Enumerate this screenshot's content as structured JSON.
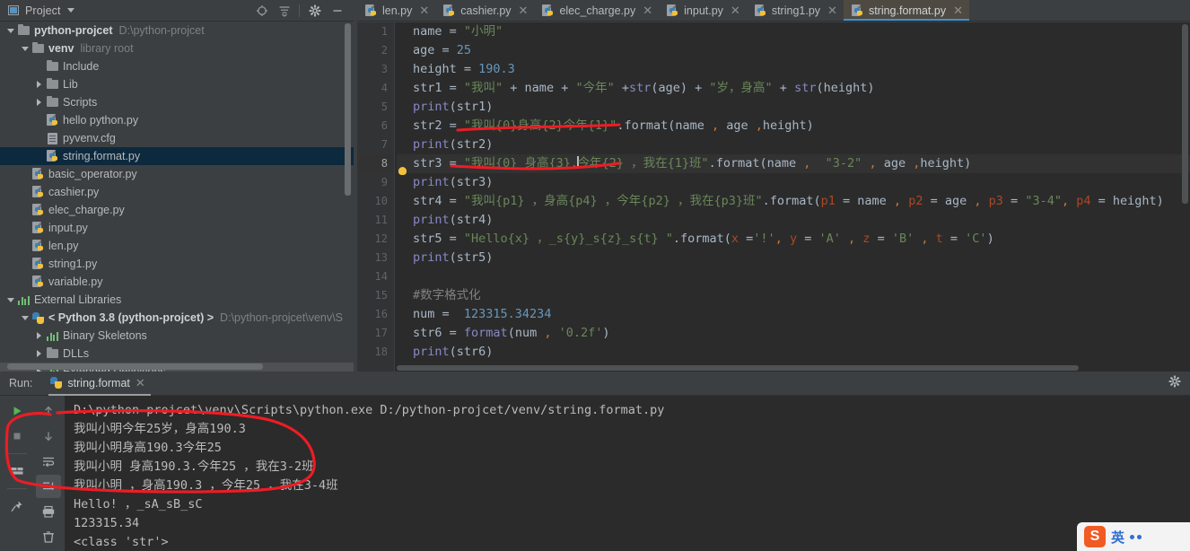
{
  "project_panel": {
    "title": "Project",
    "toolbar_icons": [
      "locate-icon",
      "collapse-all-icon",
      "settings-gear-icon",
      "minimize-icon"
    ],
    "tree": [
      {
        "indent": 0,
        "twisty": "down",
        "icon": "folder-icon",
        "label": "python-projcet",
        "bold": true,
        "dim": "D:\\python-projcet",
        "state": "normal"
      },
      {
        "indent": 1,
        "twisty": "down",
        "icon": "folder-icon",
        "label": "venv",
        "bold": true,
        "dim": "library root",
        "state": "normal"
      },
      {
        "indent": 2,
        "twisty": "none",
        "icon": "folder-icon",
        "label": "Include",
        "bold": false,
        "dim": "",
        "state": "normal"
      },
      {
        "indent": 2,
        "twisty": "right",
        "icon": "folder-icon",
        "label": "Lib",
        "bold": false,
        "dim": "",
        "state": "normal"
      },
      {
        "indent": 2,
        "twisty": "right",
        "icon": "folder-icon",
        "label": "Scripts",
        "bold": false,
        "dim": "",
        "state": "normal"
      },
      {
        "indent": 2,
        "twisty": "none",
        "icon": "python-file-icon",
        "label": "hello python.py",
        "bold": false,
        "dim": "",
        "state": "normal"
      },
      {
        "indent": 2,
        "twisty": "none",
        "icon": "cfg-file-icon",
        "label": "pyvenv.cfg",
        "bold": false,
        "dim": "",
        "state": "normal"
      },
      {
        "indent": 2,
        "twisty": "none",
        "icon": "python-file-icon",
        "label": "string.format.py",
        "bold": false,
        "dim": "",
        "state": "selected"
      },
      {
        "indent": 1,
        "twisty": "none",
        "icon": "python-file-icon",
        "label": "basic_operator.py",
        "bold": false,
        "dim": "",
        "state": "normal"
      },
      {
        "indent": 1,
        "twisty": "none",
        "icon": "python-file-icon",
        "label": "cashier.py",
        "bold": false,
        "dim": "",
        "state": "normal"
      },
      {
        "indent": 1,
        "twisty": "none",
        "icon": "python-file-icon",
        "label": "elec_charge.py",
        "bold": false,
        "dim": "",
        "state": "normal"
      },
      {
        "indent": 1,
        "twisty": "none",
        "icon": "python-file-icon",
        "label": "input.py",
        "bold": false,
        "dim": "",
        "state": "normal"
      },
      {
        "indent": 1,
        "twisty": "none",
        "icon": "python-file-icon",
        "label": "len.py",
        "bold": false,
        "dim": "",
        "state": "normal"
      },
      {
        "indent": 1,
        "twisty": "none",
        "icon": "python-file-icon",
        "label": "string1.py",
        "bold": false,
        "dim": "",
        "state": "normal"
      },
      {
        "indent": 1,
        "twisty": "none",
        "icon": "python-file-icon",
        "label": "variable.py",
        "bold": false,
        "dim": "",
        "state": "normal"
      },
      {
        "indent": 0,
        "twisty": "down",
        "icon": "library-bars-icon",
        "label": "External Libraries",
        "bold": false,
        "dim": "",
        "state": "normal"
      },
      {
        "indent": 1,
        "twisty": "down",
        "icon": "python-logo-icon",
        "label": "< Python 3.8 (python-projcet) >",
        "bold": true,
        "dim": "D:\\python-projcet\\venv\\S",
        "state": "normal"
      },
      {
        "indent": 2,
        "twisty": "right",
        "icon": "library-bars-icon",
        "label": "Binary Skeletons",
        "bold": false,
        "dim": "",
        "state": "normal"
      },
      {
        "indent": 2,
        "twisty": "right",
        "icon": "folder-icon",
        "label": "DLLs",
        "bold": false,
        "dim": "",
        "state": "normal"
      },
      {
        "indent": 2,
        "twisty": "right",
        "icon": "library-bars-icon",
        "label": "Extended Definitions",
        "bold": false,
        "dim": "",
        "state": "hover"
      }
    ]
  },
  "tabs": [
    {
      "label": "len.py",
      "active": false
    },
    {
      "label": "cashier.py",
      "active": false
    },
    {
      "label": "elec_charge.py",
      "active": false
    },
    {
      "label": "input.py",
      "active": false
    },
    {
      "label": "string1.py",
      "active": false
    },
    {
      "label": "string.format.py",
      "active": true
    }
  ],
  "editor": {
    "current_line": 8,
    "line_numbers": [
      "1",
      "2",
      "3",
      "4",
      "5",
      "6",
      "7",
      "8",
      "9",
      "10",
      "11",
      "12",
      "13",
      "14",
      "15",
      "16",
      "17",
      "18"
    ],
    "lines": [
      {
        "n": 1,
        "segments": [
          {
            "t": "name ",
            "c": "plain"
          },
          {
            "t": "= ",
            "c": "plain"
          },
          {
            "t": "\"小明\"",
            "c": "str"
          }
        ]
      },
      {
        "n": 2,
        "segments": [
          {
            "t": "age ",
            "c": "plain"
          },
          {
            "t": "= ",
            "c": "plain"
          },
          {
            "t": "25",
            "c": "num"
          }
        ]
      },
      {
        "n": 3,
        "segments": [
          {
            "t": "height ",
            "c": "plain"
          },
          {
            "t": "= ",
            "c": "plain"
          },
          {
            "t": "190.3",
            "c": "num"
          }
        ]
      },
      {
        "n": 4,
        "segments": [
          {
            "t": "str1 = ",
            "c": "plain"
          },
          {
            "t": "\"我叫\"",
            "c": "str"
          },
          {
            "t": " + name + ",
            "c": "plain"
          },
          {
            "t": "\"今年\"",
            "c": "str"
          },
          {
            "t": " +",
            "c": "plain"
          },
          {
            "t": "str",
            "c": "bi"
          },
          {
            "t": "(age) + ",
            "c": "plain"
          },
          {
            "t": "\"岁，身高\"",
            "c": "str"
          },
          {
            "t": " + ",
            "c": "plain"
          },
          {
            "t": "str",
            "c": "bi"
          },
          {
            "t": "(height)",
            "c": "plain"
          }
        ]
      },
      {
        "n": 5,
        "segments": [
          {
            "t": "print",
            "c": "bi"
          },
          {
            "t": "(str1)",
            "c": "plain"
          }
        ]
      },
      {
        "n": 6,
        "segments": [
          {
            "t": "str2 = ",
            "c": "plain"
          },
          {
            "t": "\"我叫{0}身高{2}今年{1}\"",
            "c": "str"
          },
          {
            "t": ".format(name ",
            "c": "plain"
          },
          {
            "t": ",",
            "c": "kw"
          },
          {
            "t": " age ",
            "c": "plain"
          },
          {
            "t": ",",
            "c": "kw"
          },
          {
            "t": "height)",
            "c": "plain"
          }
        ]
      },
      {
        "n": 7,
        "segments": [
          {
            "t": "print",
            "c": "bi"
          },
          {
            "t": "(str2)",
            "c": "plain"
          }
        ]
      },
      {
        "n": 8,
        "segments": [
          {
            "t": "str3 = ",
            "c": "plain"
          },
          {
            "t": "\"我叫{0} 身高{3}.",
            "c": "str"
          },
          {
            "t": "|",
            "c": "cursor"
          },
          {
            "t": "今年{2} ，我在{1}班\"",
            "c": "str"
          },
          {
            "t": ".format(name ",
            "c": "plain"
          },
          {
            "t": ",",
            "c": "kw"
          },
          {
            "t": "  ",
            "c": "plain"
          },
          {
            "t": "\"3-2\"",
            "c": "str"
          },
          {
            "t": " ",
            "c": "plain"
          },
          {
            "t": ",",
            "c": "kw"
          },
          {
            "t": " age ",
            "c": "plain"
          },
          {
            "t": ",",
            "c": "kw"
          },
          {
            "t": "height)",
            "c": "plain"
          }
        ]
      },
      {
        "n": 9,
        "segments": [
          {
            "t": "print",
            "c": "bi"
          },
          {
            "t": "(str3)",
            "c": "plain"
          }
        ]
      },
      {
        "n": 10,
        "segments": [
          {
            "t": "str4 = ",
            "c": "plain"
          },
          {
            "t": "\"我叫{p1} ，身高{p4} ，今年{p2} ，我在{p3}班\"",
            "c": "str"
          },
          {
            "t": ".format(",
            "c": "plain"
          },
          {
            "t": "p1",
            "c": "kwarg"
          },
          {
            "t": " = name ",
            "c": "plain"
          },
          {
            "t": ",",
            "c": "kw"
          },
          {
            "t": " ",
            "c": "plain"
          },
          {
            "t": "p2",
            "c": "kwarg"
          },
          {
            "t": " = age ",
            "c": "plain"
          },
          {
            "t": ",",
            "c": "kw"
          },
          {
            "t": " ",
            "c": "plain"
          },
          {
            "t": "p3",
            "c": "kwarg"
          },
          {
            "t": " = ",
            "c": "plain"
          },
          {
            "t": "\"3-4\"",
            "c": "str"
          },
          {
            "t": ",",
            "c": "kw"
          },
          {
            "t": " ",
            "c": "plain"
          },
          {
            "t": "p4",
            "c": "kwarg"
          },
          {
            "t": " = height)",
            "c": "plain"
          }
        ]
      },
      {
        "n": 11,
        "segments": [
          {
            "t": "print",
            "c": "bi"
          },
          {
            "t": "(str4)",
            "c": "plain"
          }
        ]
      },
      {
        "n": 12,
        "segments": [
          {
            "t": "str5 = ",
            "c": "plain"
          },
          {
            "t": "\"Hello{x} ，_s{y}_s{z}_s{t} \"",
            "c": "str"
          },
          {
            "t": ".format(",
            "c": "plain"
          },
          {
            "t": "x",
            "c": "kwarg"
          },
          {
            "t": " =",
            "c": "plain"
          },
          {
            "t": "'!'",
            "c": "str"
          },
          {
            "t": ", ",
            "c": "kw"
          },
          {
            "t": "y",
            "c": "kwarg"
          },
          {
            "t": " = ",
            "c": "plain"
          },
          {
            "t": "'A'",
            "c": "str"
          },
          {
            "t": " ",
            "c": "plain"
          },
          {
            "t": ",",
            "c": "kw"
          },
          {
            "t": " ",
            "c": "plain"
          },
          {
            "t": "z",
            "c": "kwarg"
          },
          {
            "t": " = ",
            "c": "plain"
          },
          {
            "t": "'B'",
            "c": "str"
          },
          {
            "t": " ",
            "c": "plain"
          },
          {
            "t": ",",
            "c": "kw"
          },
          {
            "t": " ",
            "c": "plain"
          },
          {
            "t": "t",
            "c": "kwarg"
          },
          {
            "t": " = ",
            "c": "plain"
          },
          {
            "t": "'C'",
            "c": "str"
          },
          {
            "t": ")",
            "c": "plain"
          }
        ]
      },
      {
        "n": 13,
        "segments": [
          {
            "t": "print",
            "c": "bi"
          },
          {
            "t": "(str5)",
            "c": "plain"
          }
        ]
      },
      {
        "n": 14,
        "segments": [
          {
            "t": "",
            "c": "plain"
          }
        ]
      },
      {
        "n": 15,
        "segments": [
          {
            "t": "#数字格式化",
            "c": "cmt"
          }
        ]
      },
      {
        "n": 16,
        "segments": [
          {
            "t": "num = ",
            "c": "plain"
          },
          {
            "t": " 123315.34234",
            "c": "num"
          }
        ]
      },
      {
        "n": 17,
        "segments": [
          {
            "t": "str6 = ",
            "c": "plain"
          },
          {
            "t": "format",
            "c": "bi"
          },
          {
            "t": "(num ",
            "c": "plain"
          },
          {
            "t": ",",
            "c": "kw"
          },
          {
            "t": " ",
            "c": "plain"
          },
          {
            "t": "'0.2f'",
            "c": "str"
          },
          {
            "t": ")",
            "c": "plain"
          }
        ]
      },
      {
        "n": 18,
        "segments": [
          {
            "t": "print",
            "c": "bi"
          },
          {
            "t": "(str6)",
            "c": "plain"
          }
        ]
      }
    ]
  },
  "run_panel": {
    "label": "Run:",
    "tab_label": "string.format",
    "gear_icon": "settings-gear-icon",
    "toolbar_left": [
      "run-icon",
      "stop-icon",
      "restore-layout-icon",
      "pin-icon"
    ],
    "toolbar_right": [
      "scroll-up-icon",
      "scroll-down-icon",
      "soft-wrap-icon",
      "scroll-to-end-icon",
      "print-icon",
      "clear-all-icon"
    ],
    "console_lines": [
      "D:\\python-projcet\\venv\\Scripts\\python.exe D:/python-projcet/venv/string.format.py",
      "我叫小明今年25岁，身高190.3",
      "我叫小明身高190.3今年25",
      "我叫小明 身高190.3.今年25 ，我在3-2班",
      "我叫小明 ，身高190.3 ，今年25 ，我在3-4班",
      "Hello! ，_sA_sB_sC",
      "123315.34",
      "<class 'str'>"
    ]
  },
  "ime": {
    "logo_text": "S",
    "mode_label": "英"
  },
  "colors": {
    "accent": "#3d92d4",
    "annotation": "#ee1c24",
    "selection": "#0d293e",
    "editor_bg": "#2b2b2b",
    "chrome_bg": "#3c3f41"
  }
}
